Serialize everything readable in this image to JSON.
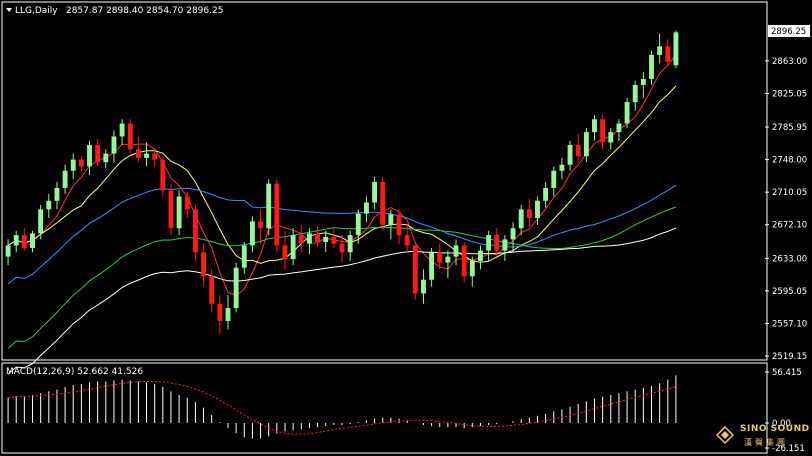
{
  "header": {
    "symbol_label": "LLG,Daily",
    "ohlc": "2857.87 2898.40 2854.70 2896.25"
  },
  "price_axis": {
    "current_price": "2896.25",
    "ticks": [
      "2863.00",
      "2825.05",
      "2785.95",
      "2748.00",
      "2710.05",
      "2672.10",
      "2633.00",
      "2595.05",
      "2557.10",
      "2519.15"
    ]
  },
  "macd": {
    "label": "MACD(12,26,9) 52.662 41.526",
    "ticks": [
      "56.415",
      "0.00",
      "-26.151"
    ]
  },
  "logo": {
    "name": "SINO SOUND",
    "subtitle": "漢聲集團"
  },
  "colors": {
    "background": "#000000",
    "bull_candle": "#98f598",
    "bear_candle": "#ff1a1a",
    "ma_fast": "#ff3030",
    "ma_mid": "#ffff66",
    "ma_blue": "#3a8dff",
    "ma_green": "#22cc44",
    "ma_white": "#ffffff",
    "signal": "#ff2020"
  },
  "chart_data": {
    "type": "candlestick",
    "title": "LLG,Daily",
    "ylim": [
      2519.15,
      2899
    ],
    "candles": [
      [
        2635,
        2655,
        2625,
        2648
      ],
      [
        2648,
        2665,
        2640,
        2660
      ],
      [
        2660,
        2668,
        2642,
        2645
      ],
      [
        2645,
        2665,
        2640,
        2662
      ],
      [
        2662,
        2695,
        2655,
        2690
      ],
      [
        2690,
        2708,
        2680,
        2700
      ],
      [
        2700,
        2722,
        2690,
        2715
      ],
      [
        2715,
        2742,
        2708,
        2735
      ],
      [
        2735,
        2755,
        2725,
        2748
      ],
      [
        2748,
        2752,
        2735,
        2740
      ],
      [
        2740,
        2770,
        2730,
        2765
      ],
      [
        2765,
        2772,
        2740,
        2745
      ],
      [
        2745,
        2760,
        2738,
        2755
      ],
      [
        2755,
        2782,
        2745,
        2775
      ],
      [
        2775,
        2795,
        2765,
        2790
      ],
      [
        2790,
        2795,
        2755,
        2760
      ],
      [
        2760,
        2775,
        2745,
        2750
      ],
      [
        2750,
        2768,
        2740,
        2755
      ],
      [
        2755,
        2760,
        2740,
        2748
      ],
      [
        2748,
        2752,
        2705,
        2712
      ],
      [
        2712,
        2720,
        2660,
        2668
      ],
      [
        2668,
        2712,
        2660,
        2705
      ],
      [
        2705,
        2710,
        2680,
        2690
      ],
      [
        2690,
        2695,
        2630,
        2640
      ],
      [
        2640,
        2650,
        2600,
        2612
      ],
      [
        2612,
        2620,
        2570,
        2580
      ],
      [
        2580,
        2590,
        2545,
        2560
      ],
      [
        2560,
        2590,
        2550,
        2575
      ],
      [
        2575,
        2628,
        2570,
        2622
      ],
      [
        2622,
        2652,
        2615,
        2648
      ],
      [
        2648,
        2682,
        2640,
        2676
      ],
      [
        2676,
        2690,
        2650,
        2668
      ],
      [
        2668,
        2725,
        2660,
        2720
      ],
      [
        2720,
        2725,
        2640,
        2648
      ],
      [
        2648,
        2665,
        2620,
        2632
      ],
      [
        2632,
        2668,
        2625,
        2660
      ],
      [
        2660,
        2672,
        2640,
        2650
      ],
      [
        2650,
        2668,
        2638,
        2662
      ],
      [
        2662,
        2670,
        2646,
        2652
      ],
      [
        2652,
        2665,
        2640,
        2658
      ],
      [
        2658,
        2668,
        2645,
        2650
      ],
      [
        2650,
        2660,
        2628,
        2640
      ],
      [
        2640,
        2665,
        2630,
        2660
      ],
      [
        2660,
        2690,
        2650,
        2685
      ],
      [
        2685,
        2705,
        2675,
        2698
      ],
      [
        2698,
        2728,
        2690,
        2722
      ],
      [
        2722,
        2728,
        2665,
        2672
      ],
      [
        2672,
        2690,
        2655,
        2684
      ],
      [
        2684,
        2690,
        2650,
        2660
      ],
      [
        2660,
        2672,
        2640,
        2648
      ],
      [
        2648,
        2650,
        2585,
        2592
      ],
      [
        2592,
        2620,
        2580,
        2608
      ],
      [
        2608,
        2645,
        2600,
        2640
      ],
      [
        2640,
        2650,
        2620,
        2628
      ],
      [
        2628,
        2642,
        2610,
        2635
      ],
      [
        2635,
        2655,
        2625,
        2648
      ],
      [
        2648,
        2652,
        2605,
        2612
      ],
      [
        2612,
        2635,
        2600,
        2630
      ],
      [
        2630,
        2648,
        2620,
        2642
      ],
      [
        2642,
        2665,
        2630,
        2660
      ],
      [
        2660,
        2668,
        2635,
        2642
      ],
      [
        2642,
        2660,
        2630,
        2655
      ],
      [
        2655,
        2675,
        2640,
        2668
      ],
      [
        2668,
        2695,
        2660,
        2690
      ],
      [
        2690,
        2702,
        2670,
        2680
      ],
      [
        2680,
        2705,
        2672,
        2700
      ],
      [
        2700,
        2722,
        2692,
        2715
      ],
      [
        2715,
        2740,
        2705,
        2735
      ],
      [
        2735,
        2750,
        2725,
        2742
      ],
      [
        2742,
        2770,
        2735,
        2765
      ],
      [
        2765,
        2778,
        2745,
        2752
      ],
      [
        2752,
        2785,
        2745,
        2780
      ],
      [
        2780,
        2800,
        2770,
        2795
      ],
      [
        2795,
        2800,
        2760,
        2768
      ],
      [
        2768,
        2785,
        2760,
        2780
      ],
      [
        2780,
        2795,
        2770,
        2790
      ],
      [
        2790,
        2820,
        2785,
        2815
      ],
      [
        2815,
        2840,
        2805,
        2835
      ],
      [
        2835,
        2850,
        2820,
        2842
      ],
      [
        2842,
        2875,
        2835,
        2870
      ],
      [
        2870,
        2895,
        2860,
        2880
      ],
      [
        2880,
        2888,
        2858,
        2862
      ],
      [
        2857.87,
        2898.4,
        2854.7,
        2896.25
      ]
    ],
    "macd_hist": [
      28,
      30,
      30,
      31,
      33,
      35,
      37,
      40,
      42,
      43,
      45,
      46,
      46,
      47,
      48,
      47,
      46,
      45,
      43,
      40,
      35,
      31,
      28,
      23,
      17,
      9,
      1,
      -5,
      -10,
      -14,
      -15,
      -15,
      -13,
      -10,
      -8,
      -7,
      -6,
      -5,
      -4,
      -3,
      -2,
      -2,
      -1,
      1,
      3,
      5,
      6,
      6,
      5,
      3,
      0,
      -2,
      -3,
      -4,
      -4,
      -4,
      -5,
      -4,
      -3,
      -2,
      -1,
      0,
      2,
      4,
      6,
      8,
      10,
      13,
      15,
      18,
      21,
      24,
      27,
      29,
      31,
      33,
      35,
      37,
      39,
      41,
      44,
      48,
      52.662
    ],
    "macd_signal": 41.526
  }
}
